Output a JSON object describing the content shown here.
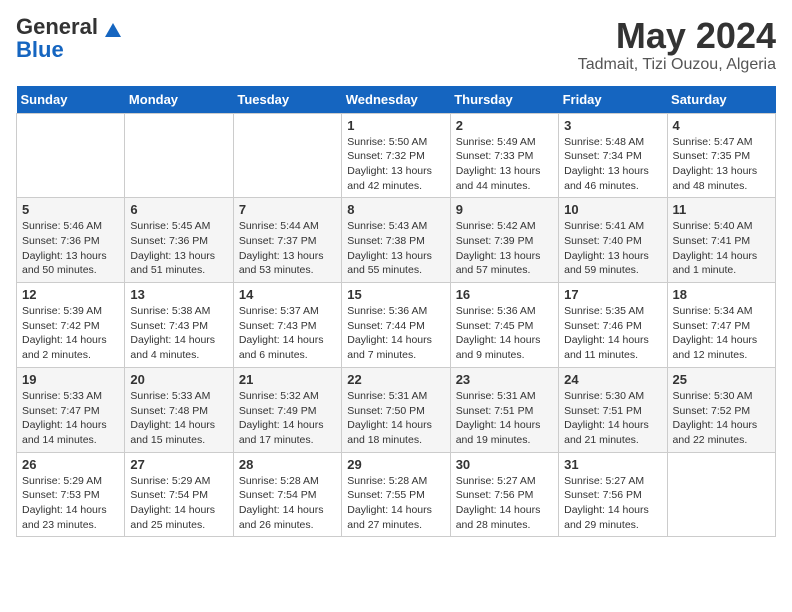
{
  "header": {
    "logo_general": "General",
    "logo_blue": "Blue",
    "month": "May 2024",
    "location": "Tadmait, Tizi Ouzou, Algeria"
  },
  "days_of_week": [
    "Sunday",
    "Monday",
    "Tuesday",
    "Wednesday",
    "Thursday",
    "Friday",
    "Saturday"
  ],
  "weeks": [
    [
      {
        "day": "",
        "info": ""
      },
      {
        "day": "",
        "info": ""
      },
      {
        "day": "",
        "info": ""
      },
      {
        "day": "1",
        "info": "Sunrise: 5:50 AM\nSunset: 7:32 PM\nDaylight: 13 hours\nand 42 minutes."
      },
      {
        "day": "2",
        "info": "Sunrise: 5:49 AM\nSunset: 7:33 PM\nDaylight: 13 hours\nand 44 minutes."
      },
      {
        "day": "3",
        "info": "Sunrise: 5:48 AM\nSunset: 7:34 PM\nDaylight: 13 hours\nand 46 minutes."
      },
      {
        "day": "4",
        "info": "Sunrise: 5:47 AM\nSunset: 7:35 PM\nDaylight: 13 hours\nand 48 minutes."
      }
    ],
    [
      {
        "day": "5",
        "info": "Sunrise: 5:46 AM\nSunset: 7:36 PM\nDaylight: 13 hours\nand 50 minutes."
      },
      {
        "day": "6",
        "info": "Sunrise: 5:45 AM\nSunset: 7:36 PM\nDaylight: 13 hours\nand 51 minutes."
      },
      {
        "day": "7",
        "info": "Sunrise: 5:44 AM\nSunset: 7:37 PM\nDaylight: 13 hours\nand 53 minutes."
      },
      {
        "day": "8",
        "info": "Sunrise: 5:43 AM\nSunset: 7:38 PM\nDaylight: 13 hours\nand 55 minutes."
      },
      {
        "day": "9",
        "info": "Sunrise: 5:42 AM\nSunset: 7:39 PM\nDaylight: 13 hours\nand 57 minutes."
      },
      {
        "day": "10",
        "info": "Sunrise: 5:41 AM\nSunset: 7:40 PM\nDaylight: 13 hours\nand 59 minutes."
      },
      {
        "day": "11",
        "info": "Sunrise: 5:40 AM\nSunset: 7:41 PM\nDaylight: 14 hours\nand 1 minute."
      }
    ],
    [
      {
        "day": "12",
        "info": "Sunrise: 5:39 AM\nSunset: 7:42 PM\nDaylight: 14 hours\nand 2 minutes."
      },
      {
        "day": "13",
        "info": "Sunrise: 5:38 AM\nSunset: 7:43 PM\nDaylight: 14 hours\nand 4 minutes."
      },
      {
        "day": "14",
        "info": "Sunrise: 5:37 AM\nSunset: 7:43 PM\nDaylight: 14 hours\nand 6 minutes."
      },
      {
        "day": "15",
        "info": "Sunrise: 5:36 AM\nSunset: 7:44 PM\nDaylight: 14 hours\nand 7 minutes."
      },
      {
        "day": "16",
        "info": "Sunrise: 5:36 AM\nSunset: 7:45 PM\nDaylight: 14 hours\nand 9 minutes."
      },
      {
        "day": "17",
        "info": "Sunrise: 5:35 AM\nSunset: 7:46 PM\nDaylight: 14 hours\nand 11 minutes."
      },
      {
        "day": "18",
        "info": "Sunrise: 5:34 AM\nSunset: 7:47 PM\nDaylight: 14 hours\nand 12 minutes."
      }
    ],
    [
      {
        "day": "19",
        "info": "Sunrise: 5:33 AM\nSunset: 7:47 PM\nDaylight: 14 hours\nand 14 minutes."
      },
      {
        "day": "20",
        "info": "Sunrise: 5:33 AM\nSunset: 7:48 PM\nDaylight: 14 hours\nand 15 minutes."
      },
      {
        "day": "21",
        "info": "Sunrise: 5:32 AM\nSunset: 7:49 PM\nDaylight: 14 hours\nand 17 minutes."
      },
      {
        "day": "22",
        "info": "Sunrise: 5:31 AM\nSunset: 7:50 PM\nDaylight: 14 hours\nand 18 minutes."
      },
      {
        "day": "23",
        "info": "Sunrise: 5:31 AM\nSunset: 7:51 PM\nDaylight: 14 hours\nand 19 minutes."
      },
      {
        "day": "24",
        "info": "Sunrise: 5:30 AM\nSunset: 7:51 PM\nDaylight: 14 hours\nand 21 minutes."
      },
      {
        "day": "25",
        "info": "Sunrise: 5:30 AM\nSunset: 7:52 PM\nDaylight: 14 hours\nand 22 minutes."
      }
    ],
    [
      {
        "day": "26",
        "info": "Sunrise: 5:29 AM\nSunset: 7:53 PM\nDaylight: 14 hours\nand 23 minutes."
      },
      {
        "day": "27",
        "info": "Sunrise: 5:29 AM\nSunset: 7:54 PM\nDaylight: 14 hours\nand 25 minutes."
      },
      {
        "day": "28",
        "info": "Sunrise: 5:28 AM\nSunset: 7:54 PM\nDaylight: 14 hours\nand 26 minutes."
      },
      {
        "day": "29",
        "info": "Sunrise: 5:28 AM\nSunset: 7:55 PM\nDaylight: 14 hours\nand 27 minutes."
      },
      {
        "day": "30",
        "info": "Sunrise: 5:27 AM\nSunset: 7:56 PM\nDaylight: 14 hours\nand 28 minutes."
      },
      {
        "day": "31",
        "info": "Sunrise: 5:27 AM\nSunset: 7:56 PM\nDaylight: 14 hours\nand 29 minutes."
      },
      {
        "day": "",
        "info": ""
      }
    ]
  ]
}
